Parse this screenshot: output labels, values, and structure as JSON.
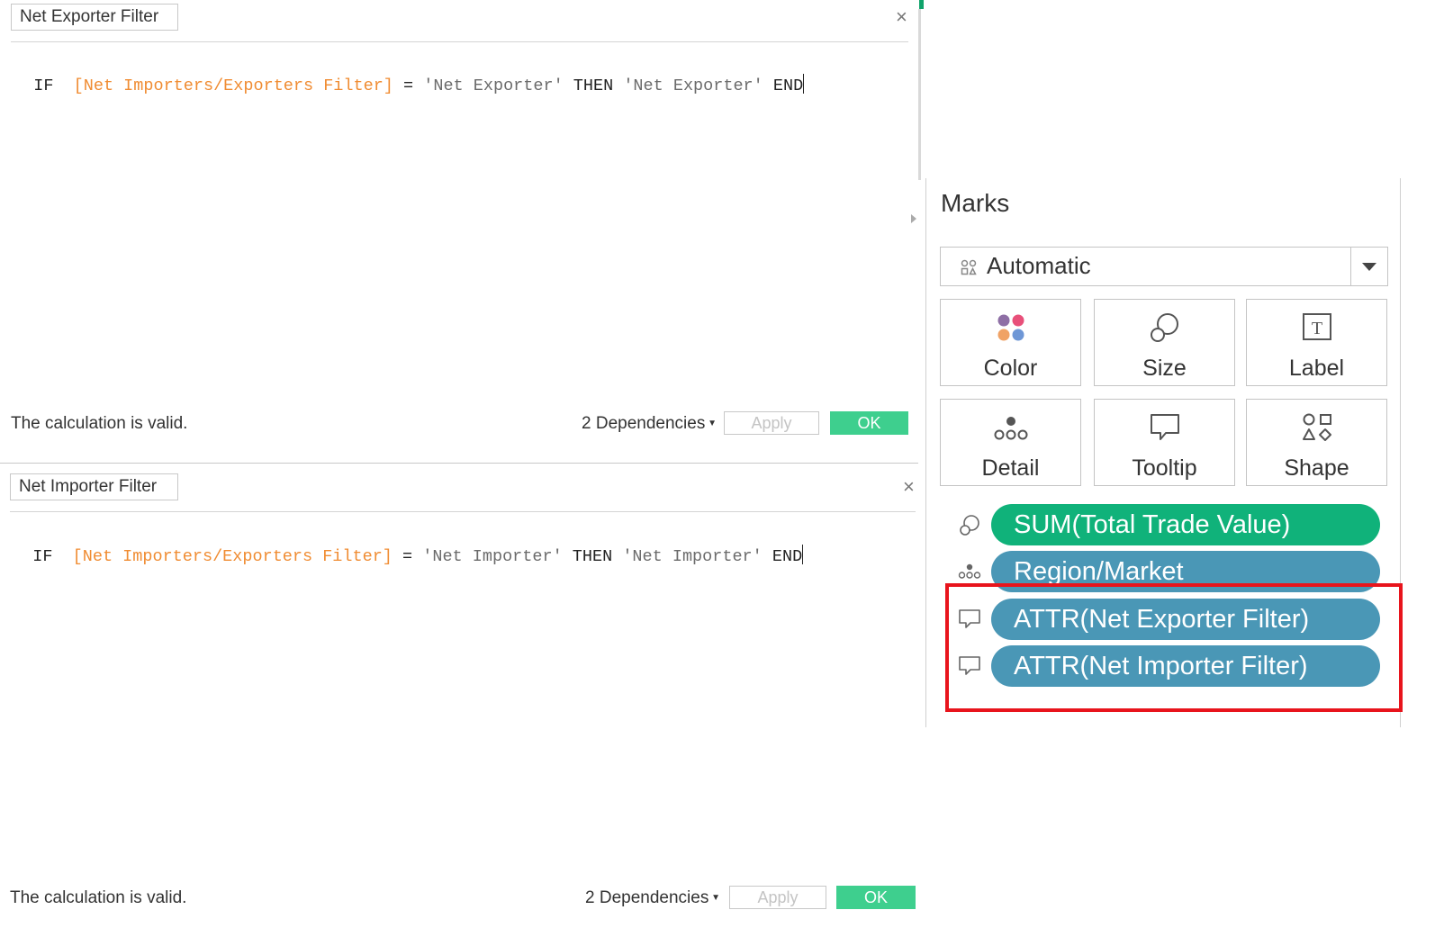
{
  "calc1": {
    "name": "Net Exporter Filter",
    "formula": {
      "kw_if": "IF",
      "field": "[Net Importers/Exporters Filter]",
      "op": "=",
      "cond_value": "'Net Exporter'",
      "kw_then": "THEN",
      "result_value": "'Net Exporter'",
      "kw_end": "END"
    },
    "status": "The calculation is valid.",
    "dependencies": "2 Dependencies",
    "apply_label": "Apply",
    "ok_label": "OK"
  },
  "calc2": {
    "name": "Net Importer Filter",
    "formula": {
      "kw_if": "IF",
      "field": "[Net Importers/Exporters Filter]",
      "op": "=",
      "cond_value": "'Net Importer'",
      "kw_then": "THEN",
      "result_value": "'Net Importer'",
      "kw_end": "END"
    },
    "status": "The calculation is valid.",
    "dependencies": "2 Dependencies",
    "apply_label": "Apply",
    "ok_label": "OK"
  },
  "marks": {
    "title": "Marks",
    "mark_type": "Automatic",
    "buttons": {
      "color": "Color",
      "size": "Size",
      "label": "Label",
      "detail": "Detail",
      "tooltip": "Tooltip",
      "shape": "Shape"
    },
    "pills": [
      {
        "label": "SUM(Total Trade Value)",
        "icon": "size-icon",
        "color": "#10b27a"
      },
      {
        "label": "Region/Market",
        "icon": "detail-icon",
        "color": "#4a97b6"
      },
      {
        "label": "ATTR(Net Exporter Filter)",
        "icon": "tooltip-icon",
        "color": "#4a97b6"
      },
      {
        "label": "ATTR(Net Importer Filter)",
        "icon": "tooltip-icon",
        "color": "#4a97b6"
      }
    ]
  },
  "colors": {
    "ok_button": "#3ecf8e",
    "field_reference": "#f08c32",
    "highlight_box": "#e8141c"
  }
}
